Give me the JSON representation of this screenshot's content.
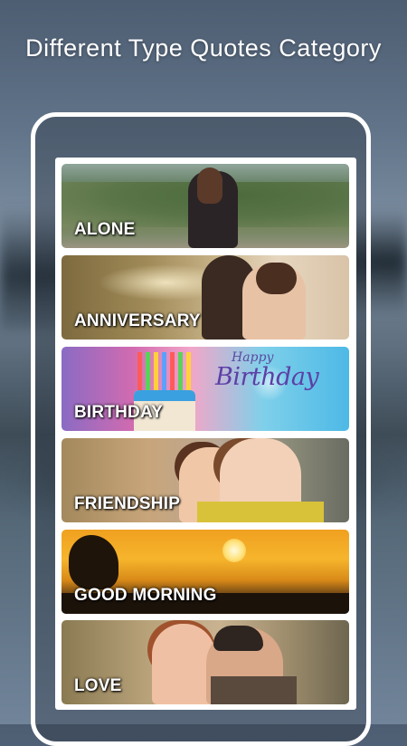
{
  "headline": "Different Type Quotes Category",
  "birthday_art": {
    "happy": "Happy",
    "birthday": "Birthday"
  },
  "categories": [
    {
      "label": "ALONE"
    },
    {
      "label": "ANNIVERSARY"
    },
    {
      "label": "BIRTHDAY"
    },
    {
      "label": "FRIENDSHIP"
    },
    {
      "label": "GOOD MORNING"
    },
    {
      "label": "LOVE"
    }
  ]
}
